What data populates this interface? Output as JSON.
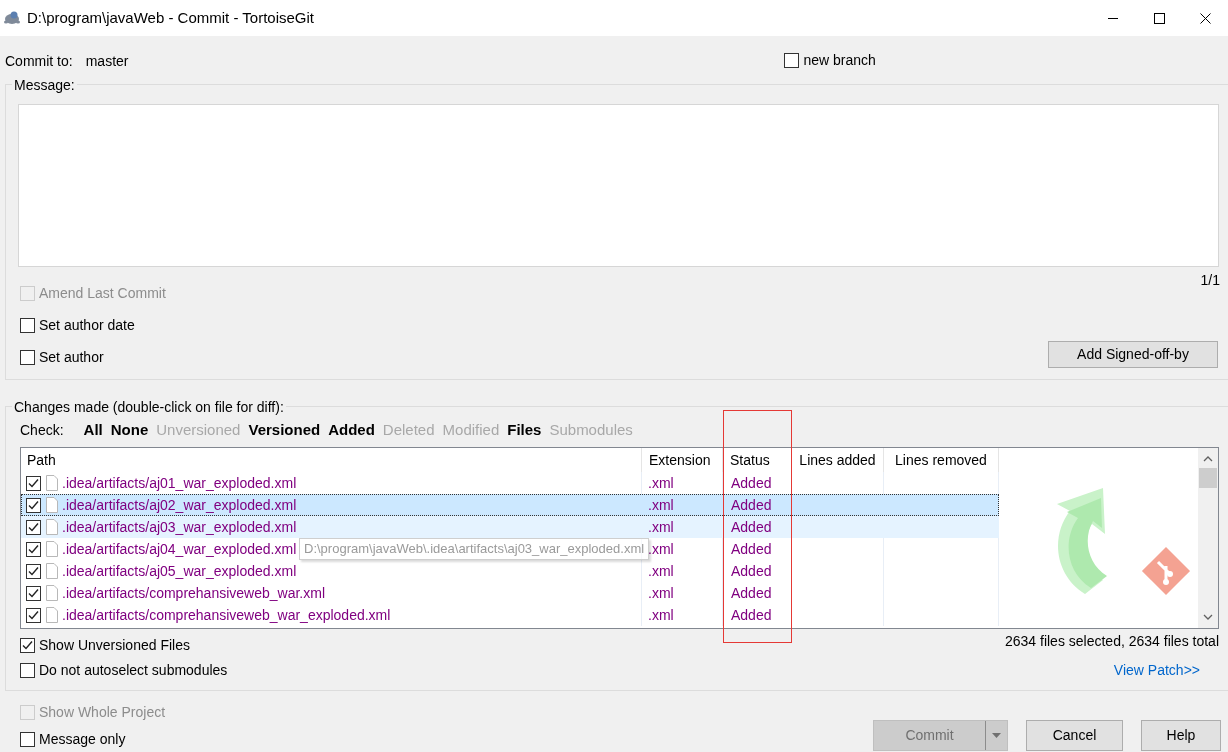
{
  "window": {
    "title": "D:\\program\\javaWeb - Commit - TortoiseGit"
  },
  "commit_to": {
    "label": "Commit to:",
    "branch": "master"
  },
  "new_branch": {
    "label": "new branch",
    "checked": false
  },
  "message": {
    "label": "Message:",
    "counter": "1/1"
  },
  "options": [
    {
      "label": "Amend Last Commit",
      "checked": false,
      "disabled": true
    },
    {
      "label": "Set author date",
      "checked": false,
      "disabled": false
    },
    {
      "label": "Set author",
      "checked": false,
      "disabled": false
    }
  ],
  "signoff_button": "Add Signed-off-by",
  "changes": {
    "label": "Changes made (double-click on file for diff):",
    "check_label": "Check:",
    "filters": [
      {
        "label": "All",
        "enabled": true
      },
      {
        "label": "None",
        "enabled": true
      },
      {
        "label": "Unversioned",
        "enabled": false
      },
      {
        "label": "Versioned",
        "enabled": true
      },
      {
        "label": "Added",
        "enabled": true
      },
      {
        "label": "Deleted",
        "enabled": false
      },
      {
        "label": "Modified",
        "enabled": false
      },
      {
        "label": "Files",
        "enabled": true
      },
      {
        "label": "Submodules",
        "enabled": false
      }
    ]
  },
  "table": {
    "columns": [
      "Path",
      "Extension",
      "Status",
      "Lines added",
      "Lines removed"
    ],
    "rows": [
      {
        "path": ".idea/artifacts/aj01_war_exploded.xml",
        "extension": ".xml",
        "status": "Added",
        "checked": true,
        "selected": false,
        "hovered": false
      },
      {
        "path": ".idea/artifacts/aj02_war_exploded.xml",
        "extension": ".xml",
        "status": "Added",
        "checked": true,
        "selected": true,
        "hovered": false
      },
      {
        "path": ".idea/artifacts/aj03_war_exploded.xml",
        "extension": ".xml",
        "status": "Added",
        "checked": true,
        "selected": false,
        "hovered": true
      },
      {
        "path": ".idea/artifacts/aj04_war_exploded.xml",
        "extension": ".xml",
        "status": "Added",
        "checked": true,
        "selected": false,
        "hovered": false
      },
      {
        "path": ".idea/artifacts/aj05_war_exploded.xml",
        "extension": ".xml",
        "status": "Added",
        "checked": true,
        "selected": false,
        "hovered": false
      },
      {
        "path": ".idea/artifacts/comprehansiveweb_war.xml",
        "extension": ".xml",
        "status": "Added",
        "checked": true,
        "selected": false,
        "hovered": false
      },
      {
        "path": ".idea/artifacts/comprehansiveweb_war_exploded.xml",
        "extension": ".xml",
        "status": "Added",
        "checked": true,
        "selected": false,
        "hovered": false
      }
    ],
    "tooltip": "D:\\program\\javaWeb\\.idea\\artifacts\\aj03_war_exploded.xml"
  },
  "list_options": [
    {
      "label": "Show Unversioned Files",
      "checked": true,
      "disabled": false
    },
    {
      "label": "Do not autoselect submodules",
      "checked": false,
      "disabled": false
    }
  ],
  "summary": "2634 files selected, 2634 files total",
  "view_patch": "View Patch>>",
  "bottom_options": [
    {
      "label": "Show Whole Project",
      "checked": false,
      "disabled": true
    },
    {
      "label": "Message only",
      "checked": false,
      "disabled": false
    }
  ],
  "buttons": [
    {
      "label": "Commit",
      "kind": "split",
      "disabled": true
    },
    {
      "label": "Cancel",
      "kind": "plain",
      "disabled": false
    },
    {
      "label": "Help",
      "kind": "plain",
      "disabled": false
    }
  ]
}
